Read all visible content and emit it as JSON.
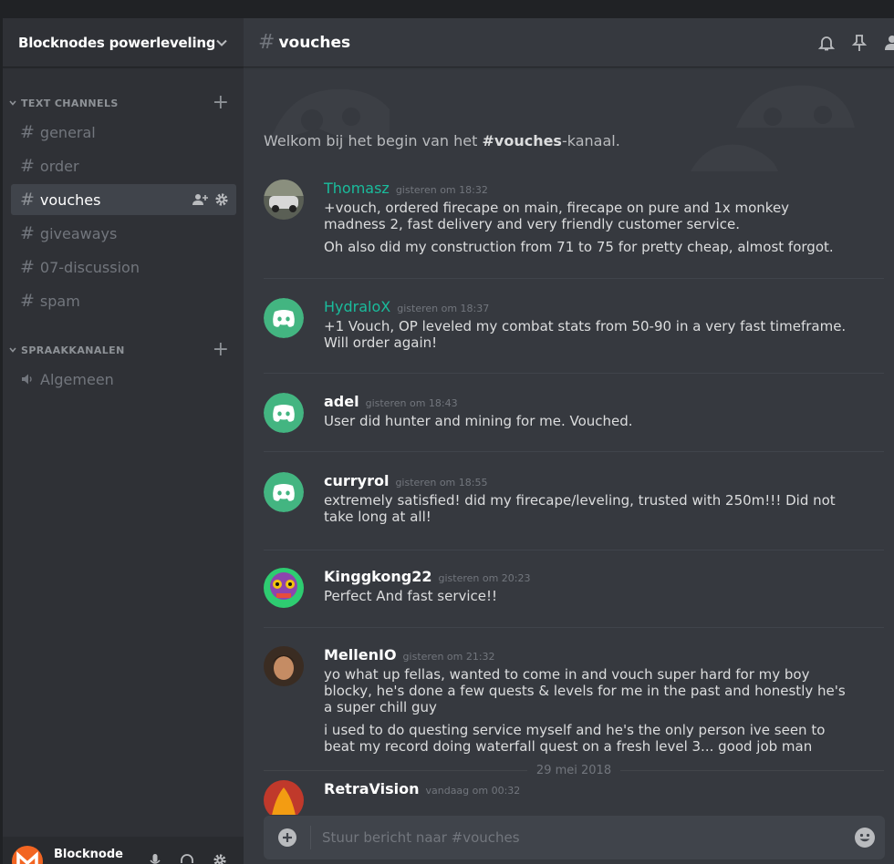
{
  "guild": {
    "name": "Blocknodes powerleveling,..."
  },
  "sidebar": {
    "text_category": "TEXT CHANNELS",
    "voice_category": "SPRAAKKANALEN",
    "text_channels": [
      "general",
      "order",
      "vouches",
      "giveaways",
      "07-discussion",
      "spam"
    ],
    "voice_channels": [
      "Algemeen"
    ],
    "active_channel": "vouches"
  },
  "user": {
    "name": "Blocknode"
  },
  "channel": {
    "name": "vouches"
  },
  "welcome": {
    "prefix": "Welkom bij het begin van het ",
    "channel": "#vouches",
    "suffix": "-kanaal."
  },
  "messages": [
    {
      "author": "Thomasz",
      "time": "gisteren om 18:32",
      "lines": [
        "+vouch, ordered firecape on main, firecape on pure and 1x monkey madness 2, fast delivery and very friendly customer service.",
        "Oh also did my construction from 71 to 75 for pretty cheap, almost forgot."
      ]
    },
    {
      "author": "HydraloX",
      "time": "gisteren om 18:37",
      "lines": [
        "+1 Vouch, OP leveled my combat stats from 50-90 in a very fast timeframe. Will order again!"
      ]
    },
    {
      "author": "adel",
      "time": "gisteren om 18:43",
      "lines": [
        "User did hunter and mining for me. Vouched."
      ]
    },
    {
      "author": "curryrol",
      "time": "gisteren om 18:55",
      "lines": [
        "extremely satisfied! did my firecape/leveling, trusted with 250m!!! Did not take long at all!"
      ]
    },
    {
      "author": "Kinggkong22",
      "time": "gisteren om 20:23",
      "lines": [
        "Perfect And fast service!!"
      ]
    },
    {
      "author": "MellenIO",
      "time": "gisteren om 21:32",
      "lines": [
        "yo what up fellas, wanted to come in and vouch super hard for my boy blocky, he's done a few quests & levels for me in the past and honestly he's a super chill guy",
        "i used to do questing service myself and he's the only person ive seen to beat my record doing waterfall quest on a fresh level 3... good job man"
      ]
    },
    {
      "author": "RetraVision",
      "time": "vandaag om 00:32",
      "lines": []
    }
  ],
  "date_divider": "29 mei 2018",
  "composer": {
    "placeholder": "Stuur bericht naar #vouches"
  },
  "colors": {
    "discord_green": "#43b581",
    "teal_author": "#1abc9c",
    "brand_orange": "#f26522"
  }
}
